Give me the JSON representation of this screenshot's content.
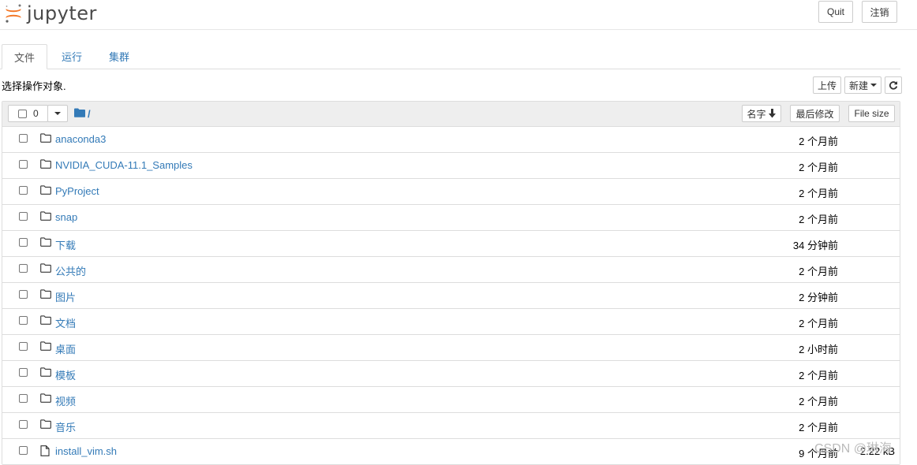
{
  "header": {
    "logo_text": "jupyter",
    "quit_label": "Quit",
    "logout_label": "注销"
  },
  "tabs": [
    {
      "label": "文件",
      "active": true
    },
    {
      "label": "运行",
      "active": false
    },
    {
      "label": "集群",
      "active": false
    }
  ],
  "toolbar": {
    "select_hint": "选择操作对象.",
    "upload_label": "上传",
    "new_label": "新建",
    "refresh_icon": "refresh-icon"
  },
  "list_header": {
    "selected_count": "0",
    "path": "/",
    "sort_name_label": "名字",
    "sort_modified_label": "最后修改",
    "sort_size_label": "File size"
  },
  "files": [
    {
      "name": "anaconda3",
      "type": "folder",
      "modified": "2 个月前",
      "size": ""
    },
    {
      "name": "NVIDIA_CUDA-11.1_Samples",
      "type": "folder",
      "modified": "2 个月前",
      "size": ""
    },
    {
      "name": "PyProject",
      "type": "folder",
      "modified": "2 个月前",
      "size": ""
    },
    {
      "name": "snap",
      "type": "folder",
      "modified": "2 个月前",
      "size": ""
    },
    {
      "name": "下载",
      "type": "folder",
      "modified": "34 分钟前",
      "size": ""
    },
    {
      "name": "公共的",
      "type": "folder",
      "modified": "2 个月前",
      "size": ""
    },
    {
      "name": "图片",
      "type": "folder",
      "modified": "2 分钟前",
      "size": ""
    },
    {
      "name": "文档",
      "type": "folder",
      "modified": "2 个月前",
      "size": ""
    },
    {
      "name": "桌面",
      "type": "folder",
      "modified": "2 小时前",
      "size": ""
    },
    {
      "name": "模板",
      "type": "folder",
      "modified": "2 个月前",
      "size": ""
    },
    {
      "name": "视频",
      "type": "folder",
      "modified": "2 个月前",
      "size": ""
    },
    {
      "name": "音乐",
      "type": "folder",
      "modified": "2 个月前",
      "size": ""
    },
    {
      "name": "install_vim.sh",
      "type": "file",
      "modified": "9 个月前",
      "size": "2.22 kB"
    }
  ],
  "watermark": "CSDN @琳海",
  "colors": {
    "link": "#337ab7",
    "accent": "#f37726"
  }
}
